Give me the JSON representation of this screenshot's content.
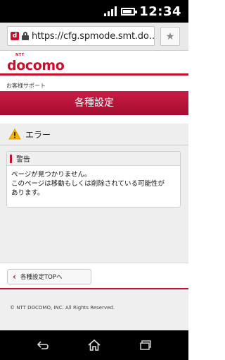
{
  "status_bar": {
    "time": "12:34"
  },
  "browser": {
    "url": "https://cfg.spmode.smt.do…",
    "favicon_letter": "d",
    "bookmark_icon": "star-icon"
  },
  "site": {
    "logo_small": "NTT",
    "logo_main": "docomo",
    "breadcrumb": "お客様サポート",
    "page_title": "各種設定"
  },
  "error": {
    "heading": "エラー",
    "alert_title": "警告",
    "alert_line1": "ページが見つかりません。",
    "alert_line2": "このページは移動もしくは削除されている可能性が",
    "alert_line3": "あります。"
  },
  "navigation": {
    "back_label": "各種設定TOPへ"
  },
  "footer": {
    "copyright": "© NTT DOCOMO, INC. All Rights Reserved."
  },
  "colors": {
    "brand": "#c8102e"
  }
}
